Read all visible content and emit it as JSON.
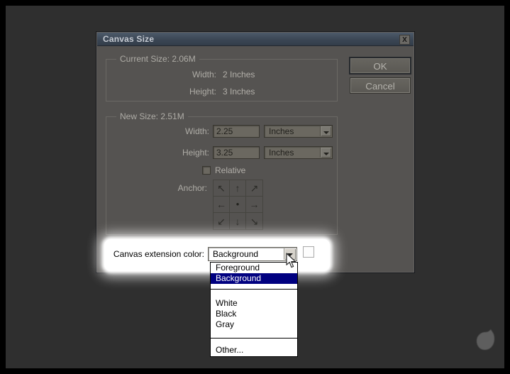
{
  "window": {
    "title": "Canvas Size",
    "close_glyph": "X"
  },
  "buttons": {
    "ok": "OK",
    "cancel": "Cancel"
  },
  "current_size": {
    "legend": "Current Size: 2.06M",
    "width_label": "Width:",
    "width_value": "2 Inches",
    "height_label": "Height:",
    "height_value": "3 Inches"
  },
  "new_size": {
    "legend": "New Size: 2.51M",
    "width_label": "Width:",
    "width_value": "2.25",
    "width_unit": "Inches",
    "height_label": "Height:",
    "height_value": "3.25",
    "height_unit": "Inches",
    "relative_label": "Relative",
    "anchor_label": "Anchor:",
    "anchor_arrows": [
      "↖",
      "↑",
      "↗",
      "←",
      "●",
      "→",
      "↙",
      "↓",
      "↘"
    ]
  },
  "extension": {
    "label": "Canvas extension color:",
    "selected_value": "Background"
  },
  "dropdown": {
    "items": [
      "Foreground",
      "Background",
      "White",
      "Black",
      "Gray",
      "Other..."
    ],
    "selected_index": 1,
    "selected_bg_color": "#000080"
  },
  "colors": {
    "desktop_background": "#2f2f2f",
    "dialog_background": "#555351",
    "titlebar": "#3b4654",
    "highlight_spotlight": "#ffffff",
    "list_selection": "#000080"
  }
}
